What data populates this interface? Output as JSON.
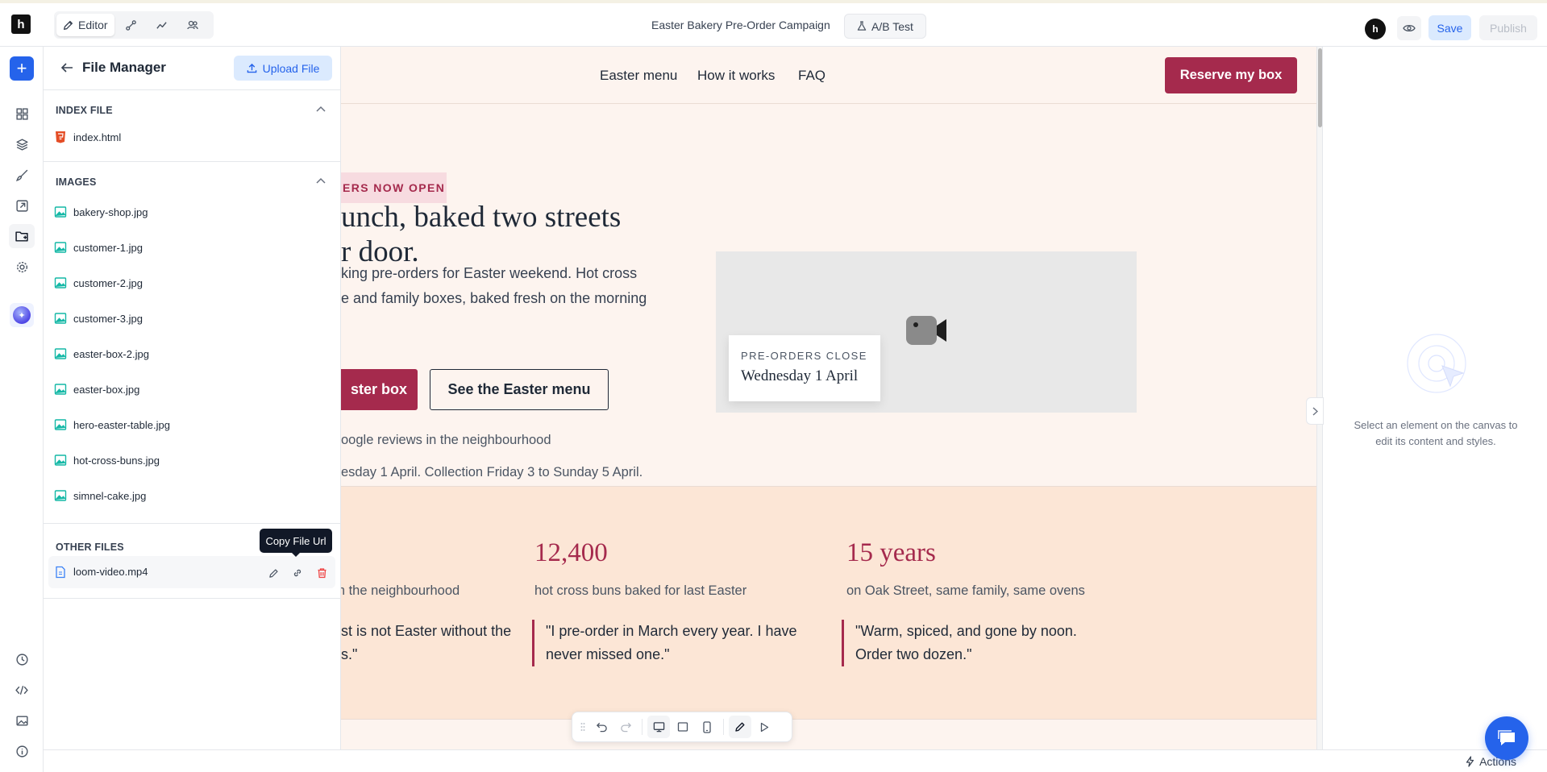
{
  "topbar": {
    "logo_letter": "h",
    "modes": [
      {
        "label": "Editor",
        "icon": "pen-icon"
      },
      {
        "label": "",
        "icon": "flow-icon"
      },
      {
        "label": "",
        "icon": "analytics-icon"
      },
      {
        "label": "",
        "icon": "users-icon"
      }
    ],
    "title": "Easter Bakery Pre-Order Campaign",
    "ab_test_label": "A/B Test",
    "avatar_letter": "h",
    "save_label": "Save",
    "publish_label": "Publish"
  },
  "file_manager": {
    "title": "File Manager",
    "upload_label": "Upload File",
    "sections": {
      "index": {
        "label": "INDEX FILE",
        "files": [
          "index.html"
        ]
      },
      "images": {
        "label": "IMAGES",
        "files": [
          "bakery-shop.jpg",
          "customer-1.jpg",
          "customer-2.jpg",
          "customer-3.jpg",
          "easter-box-2.jpg",
          "easter-box.jpg",
          "hero-easter-table.jpg",
          "hot-cross-buns.jpg",
          "simnel-cake.jpg"
        ]
      },
      "other": {
        "label": "OTHER FILES",
        "files": [
          "loom-video.mp4"
        ]
      }
    },
    "tooltip": "Copy File Url"
  },
  "site": {
    "nav_links": [
      "Easter menu",
      "How it works",
      "FAQ"
    ],
    "reserve_label": "Reserve my box",
    "badge": "ERS NOW OPEN",
    "hero_title": "unch, baked two streets r door.",
    "hero_title_lines": [
      "unch, baked two streets",
      "r door."
    ],
    "hero_sub_lines": [
      "king pre-orders for Easter weekend. Hot cross",
      "e and family boxes, baked fresh on the morning"
    ],
    "cta_primary": "ster box",
    "cta_secondary": "See the Easter menu",
    "reviews_text": "oogle reviews in the neighbourhood",
    "dates_text": "esday 1 April. Collection Friday 3 to Sunday 5 April.",
    "closing_card": {
      "label": "PRE-ORDERS CLOSE",
      "value": "Wednesday 1 April"
    },
    "stats": [
      {
        "number": "",
        "label": "from the neighbourhood",
        "quote": "st is not Easter without the s.\""
      },
      {
        "number": "12,400",
        "label": "hot cross buns baked for last Easter",
        "quote": "\"I pre-order in March every year. I have never missed one.\""
      },
      {
        "number": "15 years",
        "label": "on Oak Street, same family, same ovens",
        "quote": "\"Warm, spiced, and gone by noon. Order two dozen.\""
      }
    ]
  },
  "right_panel": {
    "empty_text": "Select an element on the canvas to edit its content and styles."
  },
  "bottombar": {
    "actions_label": "Actions"
  },
  "colors": {
    "accent": "#2563eb",
    "brand": "#a52a4d",
    "canvas_bg": "#fdf4ef",
    "stats_bg": "#fce6d6"
  }
}
